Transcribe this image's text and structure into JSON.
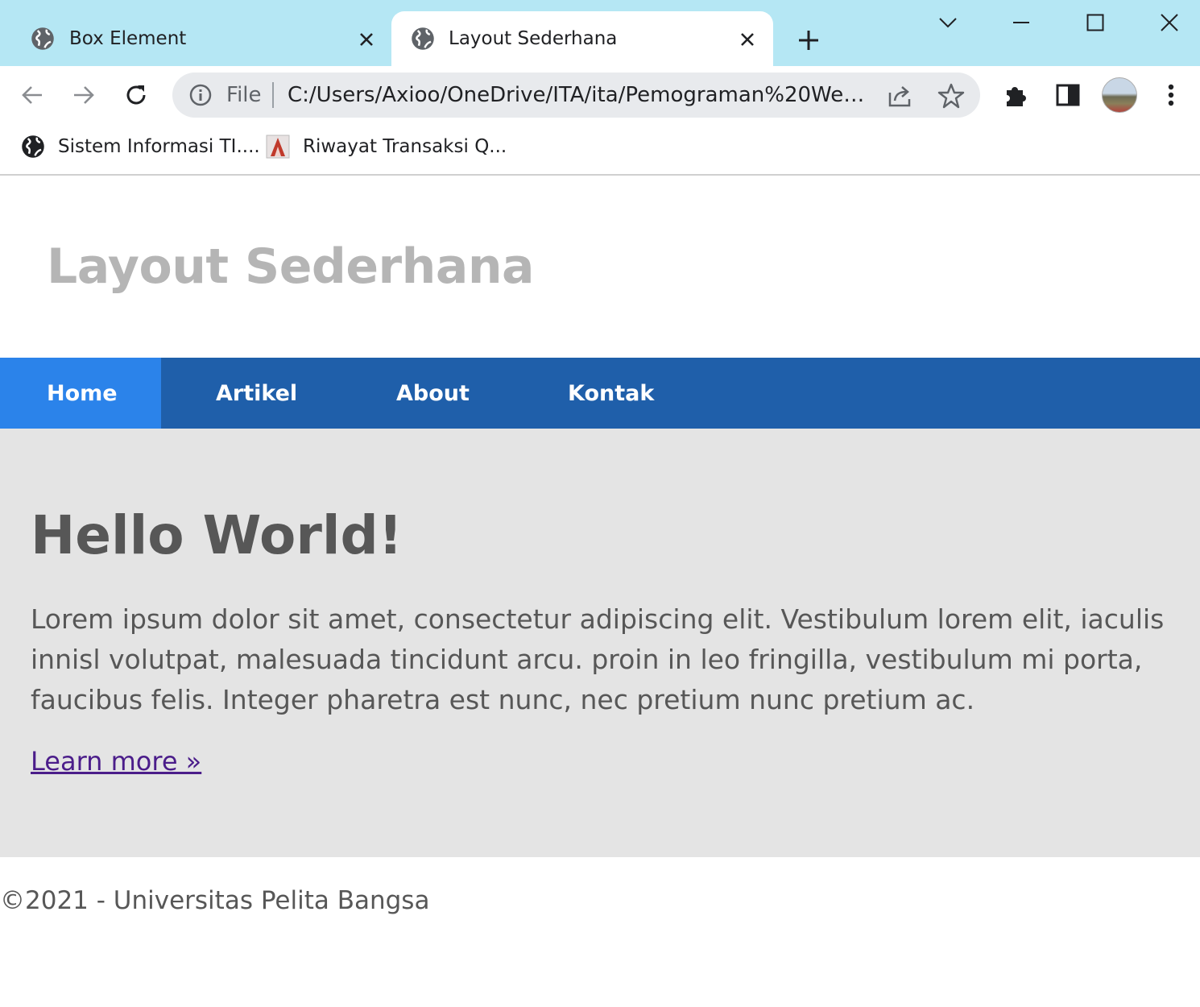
{
  "browser": {
    "tabs": [
      {
        "title": "Box Element",
        "active": false
      },
      {
        "title": "Layout Sederhana",
        "active": true
      }
    ],
    "omnibox": {
      "scheme": "File",
      "url": "C:/Users/Axioo/OneDrive/ITA/ita/Pemograman%20Web/..."
    },
    "bookmarks": [
      {
        "label": "Sistem Informasi TI....",
        "icon": "globe-icon"
      },
      {
        "label": "Riwayat Transaksi Q...",
        "icon": "app-icon"
      }
    ],
    "colors": {
      "tabstrip": "#b5e7f4",
      "omnibox": "#e8eaed"
    }
  },
  "page": {
    "header": {
      "title": "Layout Sederhana"
    },
    "nav": {
      "items": [
        {
          "label": "Home",
          "active": true
        },
        {
          "label": "Artikel",
          "active": false
        },
        {
          "label": "About",
          "active": false
        },
        {
          "label": "Kontak",
          "active": false
        }
      ]
    },
    "hero": {
      "heading": "Hello World!",
      "body": "Lorem ipsum dolor sit amet, consectetur adipiscing elit. Vestibulum lorem elit, iaculis innisl volutpat, malesuada tincidunt arcu. proin in leo fringilla, vestibulum mi porta, faucibus felis. Integer pharetra est nunc, nec pretium nunc pretium ac.",
      "link": "Learn more »"
    },
    "footer": {
      "text": "©2021 - Universitas Pelita Bangsa"
    },
    "colors": {
      "nav": "#1f5faa",
      "nav_active": "#2b83ea",
      "hero_bg": "#e4e4e4",
      "title": "#b5b5b5",
      "text": "#575757",
      "link": "#4b1d8a"
    }
  }
}
